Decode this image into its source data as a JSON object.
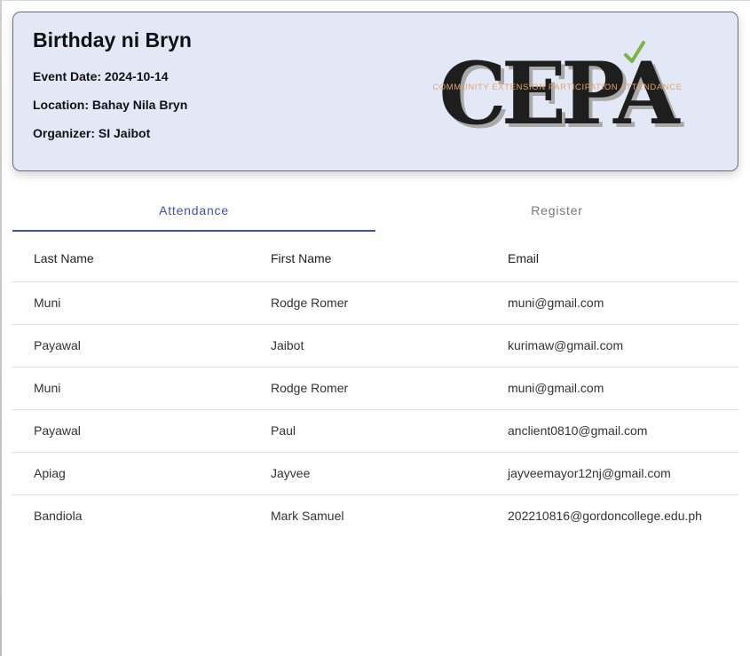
{
  "event": {
    "title": "Birthday ni Bryn",
    "date_label": "Event Date: 2024-10-14",
    "location_label": "Location: Bahay Nila Bryn",
    "organizer_label": "Organizer: SI Jaibot"
  },
  "logo": {
    "letters": "CEPA",
    "tagline": "COMMUNITY EXTENSION PARTICIPATION ATTENDANCE",
    "letter_color": "#1e1e1e",
    "shadow_color": "#a9a9a9",
    "accent_color": "#e3a46d",
    "check_color": "#7cb342"
  },
  "tabs": [
    {
      "label": "Attendance",
      "active": true
    },
    {
      "label": "Register",
      "active": false
    }
  ],
  "table": {
    "headers": [
      "Last Name",
      "First Name",
      "Email"
    ],
    "rows": [
      [
        "Muni",
        "Rodge Romer",
        "muni@gmail.com"
      ],
      [
        "Payawal",
        "Jaibot",
        "kurimaw@gmail.com"
      ],
      [
        "Muni",
        "Rodge Romer",
        "muni@gmail.com"
      ],
      [
        "Payawal",
        "Paul",
        "anclient0810@gmail.com"
      ],
      [
        "Apiag",
        "Jayvee",
        "jayveemayor12nj@gmail.com"
      ],
      [
        "Bandiola",
        "Mark Samuel",
        "202210816@gordoncollege.edu.ph"
      ]
    ]
  },
  "colors": {
    "card_bg": "#e3e8f7",
    "accent": "#3f51b5"
  }
}
